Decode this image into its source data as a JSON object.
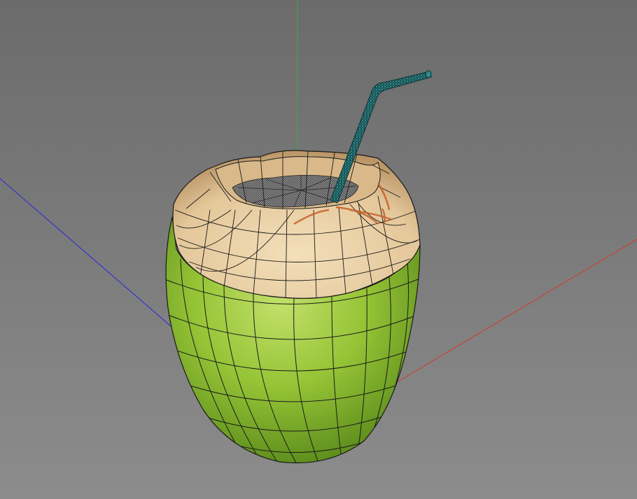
{
  "viewport": {
    "background_top": "#6b6b6b",
    "background_bottom": "#8c8c8c"
  },
  "axes": {
    "x_color": "#d23a2a",
    "y_color": "#2fb52f",
    "z_color": "#2a2ad8"
  },
  "model": {
    "object": "coconut-with-straw",
    "display_mode": "textured-wireframe",
    "husk_color": "#8fc234",
    "husk_highlight": "#b3d95a",
    "husk_shadow": "#4f7f16",
    "cut_color": "#ead0a6",
    "cut_shadow": "#b89466",
    "straw_color": "#2f8a8d",
    "wire_color": "#1a1a1a",
    "stain_color": "#c45a22"
  }
}
